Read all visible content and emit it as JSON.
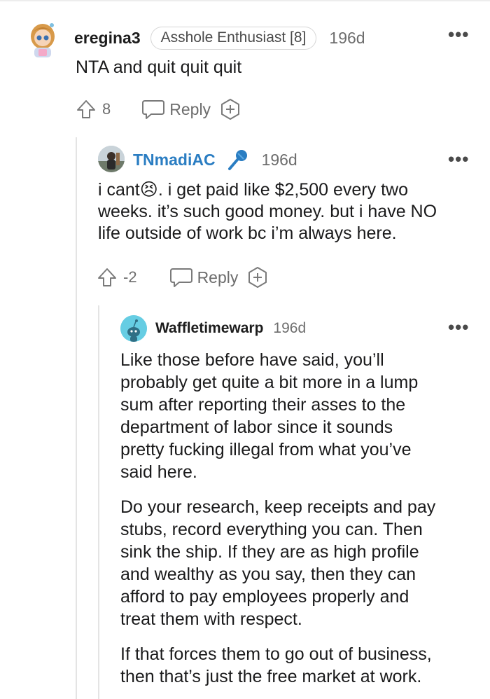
{
  "comments": [
    {
      "username": "eregina3",
      "flair": "Asshole Enthusiast [8]",
      "age": "196d",
      "body": "NTA and quit quit quit",
      "score": "8",
      "reply_label": "Reply"
    },
    {
      "username": "TNmadiAC",
      "age": "196d",
      "body_lines": [
        "i cant😣. i get paid like $2,500 every two",
        "weeks. it’s such good money. but i have NO",
        "life outside of work bc i’m always here."
      ],
      "score": "-2",
      "reply_label": "Reply"
    },
    {
      "username": "Waffletimewarp",
      "age": "196d",
      "paragraphs": [
        [
          "Like those before have said, you’ll",
          "probably get quite a bit more in a lump",
          "sum after reporting their asses to the",
          "department of labor since it sounds",
          "pretty fucking illegal from what you’ve",
          "said here."
        ],
        [
          "Do your research, keep receipts and pay",
          "stubs, record everything you can. Then",
          "sink the ship. If they are as high profile",
          "and wealthy as you say, then they can",
          "afford to pay employees properly and",
          "treat them with respect."
        ],
        [
          "If that forces them to go out of business,",
          "then that’s just the free market at work."
        ]
      ]
    }
  ],
  "icons": {
    "upvote": "upvote-arrow-icon",
    "reply": "speech-bubble-icon",
    "award": "add-award-icon",
    "more": "more-options-icon",
    "mic": "microphone-emoji-icon"
  },
  "colors": {
    "username_blue": "#2a7dc2",
    "thread_line": "#e4e4e4",
    "muted": "#6d6d6d"
  }
}
